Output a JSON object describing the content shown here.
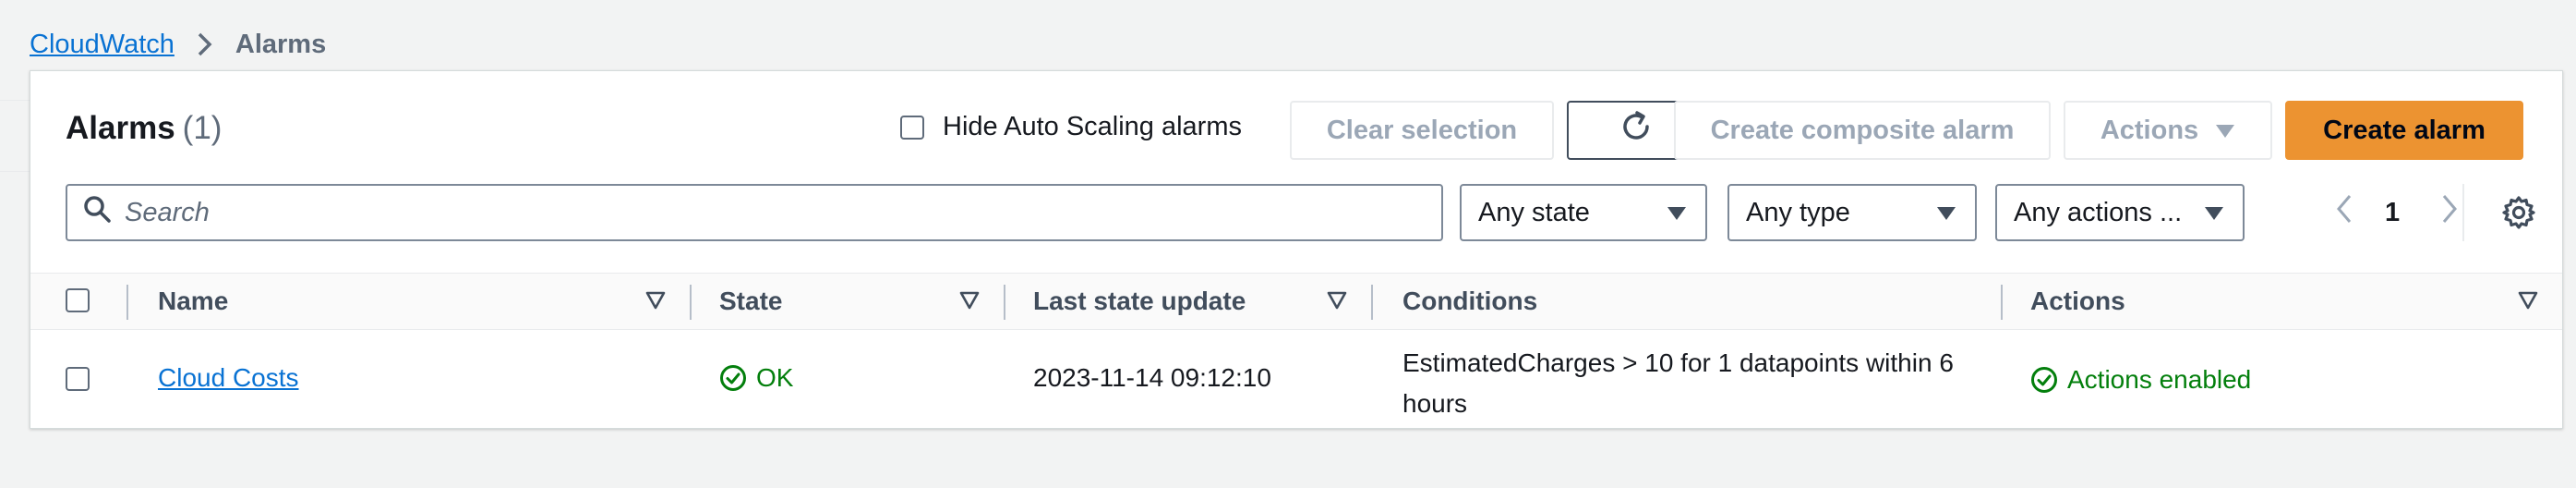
{
  "breadcrumb": {
    "root": "CloudWatch",
    "current": "Alarms"
  },
  "panel": {
    "title": "Alarms",
    "count": "(1)",
    "hide_autoscaling_label": "Hide Auto Scaling alarms",
    "buttons": {
      "clear_selection": "Clear selection",
      "create_composite": "Create composite alarm",
      "actions": "Actions",
      "create_alarm": "Create alarm"
    },
    "search": {
      "placeholder": "Search"
    },
    "filters": {
      "state": "Any state",
      "type": "Any type",
      "actions": "Any actions ..."
    },
    "pagination": {
      "page": "1"
    }
  },
  "table": {
    "headers": {
      "name": "Name",
      "state": "State",
      "last_update": "Last state update",
      "conditions": "Conditions",
      "actions": "Actions"
    },
    "rows": [
      {
        "name": "Cloud Costs",
        "state": "OK",
        "last_update": "2023-11-14 09:12:10",
        "conditions_line1": "EstimatedCharges > 10 for 1 datapoints within 6",
        "conditions_line2": "hours",
        "actions": "Actions enabled"
      }
    ]
  },
  "colors": {
    "accent": "#ec9331",
    "link": "#0972d3",
    "success": "#037f0c",
    "background": "#f2f3f3"
  }
}
